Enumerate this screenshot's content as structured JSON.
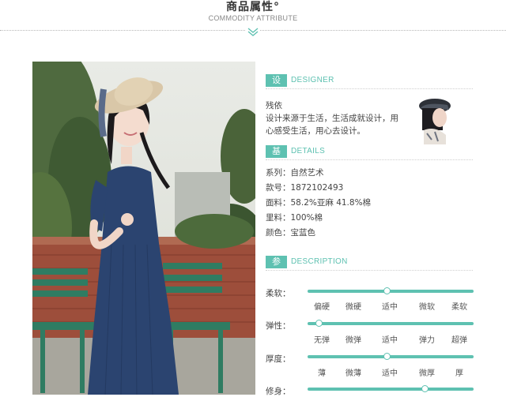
{
  "header": {
    "title": "商品属性°",
    "subtitle": "COMMODITY ATTRIBUTE"
  },
  "colors": {
    "accent": "#5ec1b1"
  },
  "designer": {
    "tag": "设计师",
    "tag_en": "DESIGNER",
    "name": "残依",
    "line1": "设计来源于生活，生活成就设计，用",
    "line2": "心感受生活，用心去设计。"
  },
  "details": {
    "tag": "基本信息",
    "tag_en": "DETAILS",
    "items": [
      "系列：自然艺术",
      "款号：1872102493",
      "面料：58.2%亚麻 41.8%棉",
      "里料：100%棉",
      "颜色：宝蓝色"
    ]
  },
  "reference": {
    "tag": "参考指标",
    "tag_en": "DESCRIPTION",
    "metrics": [
      {
        "label": "柔软：",
        "options": [
          "偏硬",
          "微硬",
          "适中",
          "微软",
          "柔软"
        ],
        "selected_index": 2
      },
      {
        "label": "弹性：",
        "options": [
          "无弹",
          "微弹",
          "适中",
          "弹力",
          "超弹"
        ],
        "selected_index": 0
      },
      {
        "label": "厚度：",
        "options": [
          "薄",
          "微薄",
          "适中",
          "微厚",
          "厚"
        ],
        "selected_index": 2
      },
      {
        "label": "修身：",
        "options": [],
        "selected_index": 3
      }
    ]
  }
}
